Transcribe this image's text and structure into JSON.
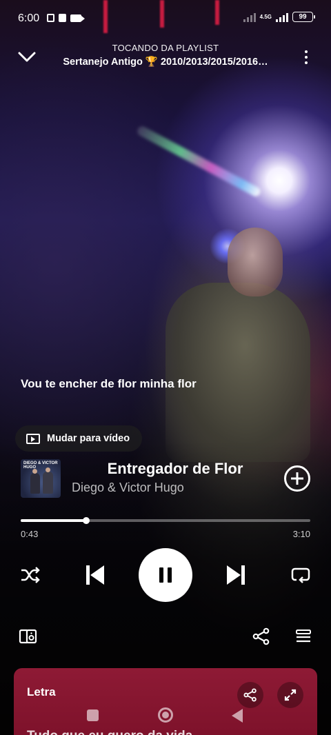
{
  "status_bar": {
    "time": "6:00",
    "network": "4.5G",
    "battery": "99"
  },
  "header": {
    "subtitle": "TOCANDO DA PLAYLIST",
    "playlist": "Sertanejo Antigo 🏆 2010/2013/2015/2016…"
  },
  "lyric_line": "Vou te encher de flor minha flor",
  "video_toggle": {
    "label": "Mudar para vídeo"
  },
  "track": {
    "cover_text": "DIEGO & VICTOR HUGO",
    "title": "Entregador de Flor",
    "artist": "Diego & Victor Hugo",
    "elapsed": "0:43",
    "total": "3:10",
    "progress": 0.226
  },
  "lyrics_card": {
    "title": "Letra",
    "next_line": "Tudo que eu quero da vida"
  },
  "colors": {
    "accent": "#ffffff",
    "lyrics_card": "#8e1a35"
  },
  "icons": [
    "chevron-down-icon",
    "more-vert-icon",
    "shuffle-icon",
    "skip-previous-icon",
    "pause-icon",
    "skip-next-icon",
    "repeat-icon",
    "devices-icon",
    "share-icon",
    "queue-icon",
    "expand-icon"
  ]
}
